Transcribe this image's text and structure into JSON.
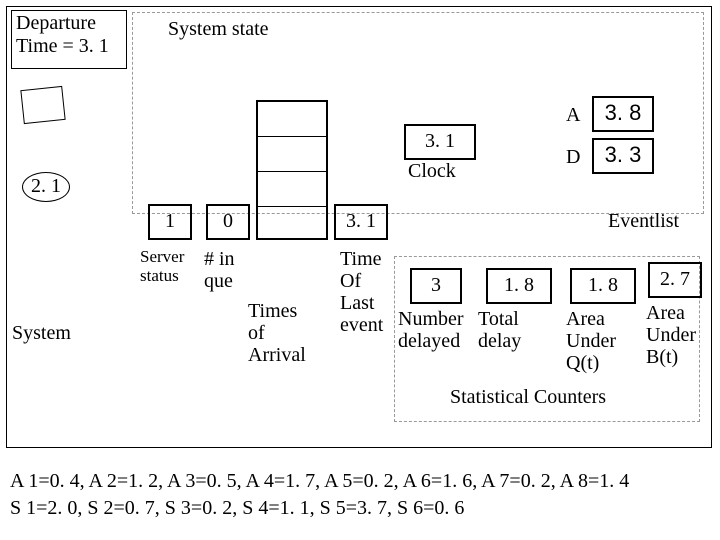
{
  "departure_box": {
    "line1": "Departure",
    "line2": "Time = 3. 1"
  },
  "system_state_label": "System state",
  "ellipse_val": "2. 1",
  "server_status": {
    "box": "1",
    "label1": "Server",
    "label2": "status"
  },
  "queue": {
    "box": "0",
    "label1": "# in",
    "label2": "que"
  },
  "times_label": {
    "l1": "Times",
    "l2": "of",
    "l3": "Arrival"
  },
  "arrival_head": "3. 1",
  "clock": {
    "val": "3. 1",
    "label": "Clock"
  },
  "timeof": {
    "l1": "Time",
    "l2": "Of",
    "l3": "Last",
    "l4": "event"
  },
  "events": {
    "A_label": "A",
    "A_val": "3. 8",
    "D_label": "D",
    "D_val": "3. 3",
    "list_label": "Eventlist"
  },
  "counters": {
    "c1": {
      "val": "3",
      "l1": "Number",
      "l2": "delayed"
    },
    "c2": {
      "val": "1. 8",
      "l1": "Total",
      "l2": "delay"
    },
    "c3": {
      "val": "1. 8",
      "l1": "Area",
      "l2": "Under",
      "l3": "Q(t)"
    },
    "c4": {
      "val": "2. 7",
      "l1": "Area",
      "l2": "Under",
      "l3": "B(t)"
    },
    "heading": "Statistical Counters"
  },
  "system_label": "System",
  "footer": {
    "line1": "A 1=0. 4, A 2=1. 2, A 3=0. 5, A 4=1. 7, A 5=0. 2, A 6=1. 6, A 7=0. 2, A 8=1. 4",
    "line2": "S 1=2. 0, S 2=0. 7, S 3=0. 2, S 4=1. 1, S 5=3. 7, S 6=0. 6"
  }
}
